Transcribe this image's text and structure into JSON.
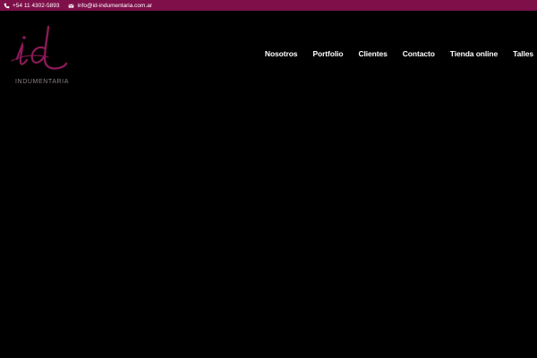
{
  "topbar": {
    "phone": "+54 11 4302-5893",
    "email": "info@id-indumentaria.com.ar",
    "background": "#7e0f49"
  },
  "logo": {
    "mark": "id",
    "wordmark": "INDUMENTARIA",
    "color": "#8b1a57"
  },
  "nav": {
    "items": [
      {
        "label": "Nosotros"
      },
      {
        "label": "Portfolio"
      },
      {
        "label": "Clientes"
      },
      {
        "label": "Contacto"
      },
      {
        "label": "Tienda online"
      },
      {
        "label": "Talles"
      }
    ]
  },
  "icons": {
    "phone": "phone-icon",
    "email": "envelope-icon"
  }
}
